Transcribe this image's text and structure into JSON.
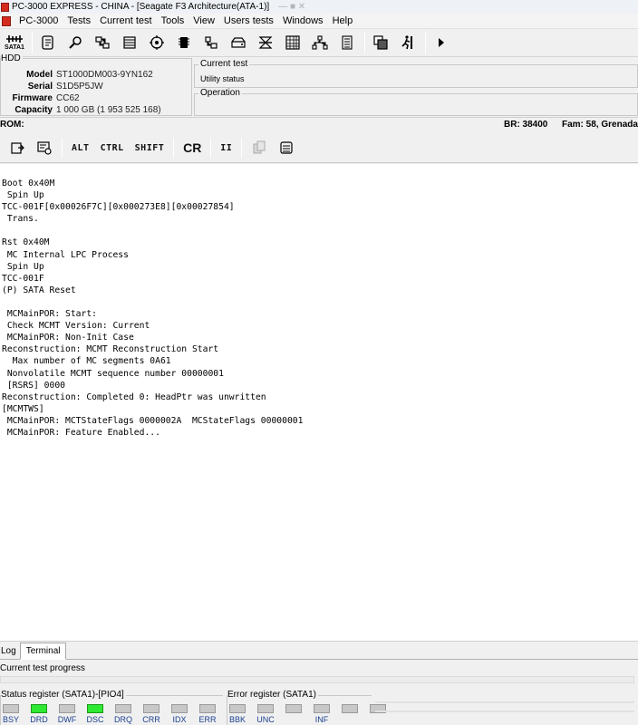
{
  "window": {
    "title": "PC-3000 EXPRESS - CHINA - [Seagate F3 Architecture(ATA-1)]",
    "ghost": "—  ■  ✕"
  },
  "menu": {
    "items": [
      "PC-3000",
      "Tests",
      "Current test",
      "Tools",
      "View",
      "Users tests",
      "Windows",
      "Help"
    ]
  },
  "toolbar": {
    "sata_label": "SATA1",
    "icons": [
      "scroll-icon",
      "search-icon",
      "ports-icon",
      "table-icon",
      "disk-gear-icon",
      "chip-icon",
      "hierarchy-icon",
      "hdd-icon",
      "transfer-icon",
      "grid-icon",
      "network-icon",
      "list-icon",
      "windows-icon",
      "runner-icon",
      "play-icon"
    ]
  },
  "hdd": {
    "caption": "HDD",
    "rows": [
      {
        "key": "Model",
        "value": "ST1000DM003-9YN162"
      },
      {
        "key": "Serial",
        "value": "S1D5P5JW"
      },
      {
        "key": "Firmware",
        "value": "CC62"
      },
      {
        "key": "Capacity",
        "value": "1 000 GB (1 953 525 168)"
      }
    ]
  },
  "current_test": {
    "caption": "Current test",
    "status": "Utility status",
    "operation_caption": "Operation"
  },
  "rom": {
    "label": "ROM:",
    "br": "BR: 38400",
    "fam": "Fam: 58, Grenada"
  },
  "terminal_toolbar": {
    "alt": "ALT",
    "ctrl": "CTRL",
    "shift": "SHIFT",
    "cr": "CR",
    "pause": "II"
  },
  "terminal": {
    "lines": [
      "Boot 0x40M",
      " Spin Up",
      "TCC-001F[0x00026F7C][0x000273E8][0x00027854]",
      " Trans.",
      "",
      "Rst 0x40M",
      " MC Internal LPC Process",
      " Spin Up",
      "TCC-001F",
      "(P) SATA Reset",
      "",
      " MCMainPOR: Start:",
      " Check MCMT Version: Current",
      " MCMainPOR: Non-Init Case",
      "Reconstruction: MCMT Reconstruction Start",
      "  Max number of MC segments 0A61",
      " Nonvolatile MCMT sequence number 00000001",
      " [RSRS] 0000",
      "Reconstruction: Completed 0: HeadPtr was unwritten",
      "[MCMTWS]",
      " MCMainPOR: MCTStateFlags 0000002A  MCStateFlags 00000001",
      " MCMainPOR: Feature Enabled..."
    ]
  },
  "tabs": [
    {
      "label": "Log",
      "active": false
    },
    {
      "label": "Terminal",
      "active": true
    }
  ],
  "progress": {
    "label": "Current test progress",
    "value": 0.0
  },
  "status_register": {
    "caption": "Status register (SATA1)-[PIO4]",
    "bits": [
      {
        "name": "BSY",
        "on": false
      },
      {
        "name": "DRD",
        "on": true
      },
      {
        "name": "DWF",
        "on": false
      },
      {
        "name": "DSC",
        "on": true
      },
      {
        "name": "DRQ",
        "on": false
      },
      {
        "name": "CRR",
        "on": false
      },
      {
        "name": "IDX",
        "on": false
      },
      {
        "name": "ERR",
        "on": false
      }
    ]
  },
  "error_register": {
    "caption": "Error register (SATA1)",
    "bits": [
      {
        "name": "BBK",
        "on": false
      },
      {
        "name": "UNC",
        "on": false
      },
      {
        "name": "",
        "on": false
      },
      {
        "name": "INF",
        "on": false
      },
      {
        "name": "",
        "on": false
      },
      {
        "name": "",
        "on": false
      }
    ]
  },
  "colors": {
    "led_on": "#2ee832",
    "led_off": "#c8c8c8",
    "reg_label": "#1a3f8f"
  }
}
